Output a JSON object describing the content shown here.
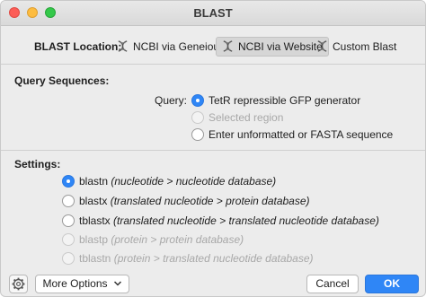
{
  "window": {
    "title": "BLAST"
  },
  "blast_location": {
    "label": "BLAST Location:",
    "options": [
      {
        "label": "NCBI via Geneious",
        "icon": "dna-icon",
        "selected": false
      },
      {
        "label": "NCBI via Website",
        "icon": "dna-icon",
        "selected": true
      },
      {
        "label": "Custom Blast",
        "icon": "dna-icon",
        "selected": false
      }
    ]
  },
  "query_sequences": {
    "heading": "Query Sequences:",
    "query_label": "Query:",
    "options": [
      {
        "label": "TetR repressible GFP generator",
        "state": "checked"
      },
      {
        "label": "Selected region",
        "state": "disabled"
      },
      {
        "label": "Enter unformatted or FASTA sequence",
        "state": "unchecked"
      }
    ]
  },
  "settings": {
    "heading": "Settings:",
    "programs": [
      {
        "name": "blastn",
        "desc": "(nucleotide > nucleotide database)",
        "state": "checked"
      },
      {
        "name": "blastx",
        "desc": "(translated nucleotide > protein database)",
        "state": "unchecked"
      },
      {
        "name": "tblastx",
        "desc": "(translated nucleotide > translated nucleotide database)",
        "state": "unchecked"
      },
      {
        "name": "blastp",
        "desc": "(protein > protein database)",
        "state": "disabled"
      },
      {
        "name": "tblastn",
        "desc": "(protein > translated nucleotide database)",
        "state": "disabled"
      }
    ]
  },
  "footer": {
    "settings_icon": "gear-icon",
    "more_options_label": "More Options",
    "cancel_label": "Cancel",
    "ok_label": "OK"
  },
  "colors": {
    "accent": "#2f86f6",
    "disabled_text": "#a8a8a8"
  }
}
